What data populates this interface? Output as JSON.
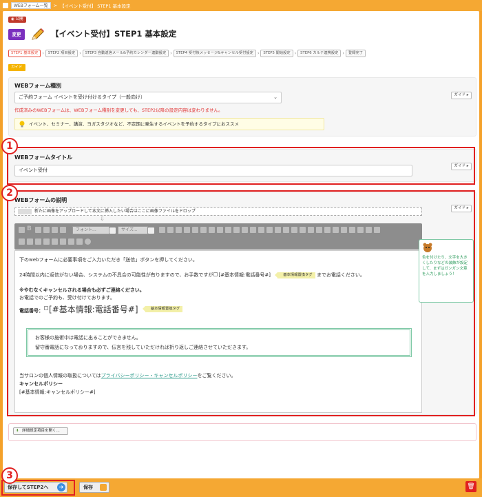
{
  "breadcrumb": {
    "home": "WEBフォーム一覧",
    "current": "【イベント受付】 STEP1 基本設定"
  },
  "status_badge": "公開",
  "edit_label": "変更",
  "page_title": "【イベント受付】STEP1 基本設定",
  "steps": [
    "STEP1 基本設定",
    "STEP2 項目設定",
    "STEP3 自動返信メール&予約カレンダー連動設定",
    "STEP4 受付後メッセージ&キャンセル受付設定",
    "STEP5 開始設定",
    "STEP6 カルテ連携設定",
    "登録完了"
  ],
  "guide_label": "ガイド",
  "form_type": {
    "title": "WEBフォーム種別",
    "selected": "ご予約フォーム イベントを受け付けるタイプ（一般向け）",
    "warning": "作成済みのWEBフォームは、WEBフォーム種別を変更しても、STEP2以降の設定内容は変わりません。",
    "hint": "イベント、セミナー、講演、ヨガスタジオなど、不定期に発生するイベントを予約するタイプにおススメ",
    "guide": "ガイド ▸"
  },
  "form_title_section": {
    "title": "WEBフォームタイトル",
    "value": "イベント受付",
    "guide": "ガイド ▸"
  },
  "description_section": {
    "title": "WEBフォームの説明",
    "guide": "ガイド ▸",
    "dropzone": "新たに画像をアップロードして本文に挿入したい場合はここに画像ファイルをドロップ",
    "font_placeholder": "フォント...",
    "size_placeholder": "サイズ...",
    "body": {
      "line1": "下のwebフォームに必要事項をご入力いただき「送信」ボタンを押してください。",
      "line2a": "24時間以内に返信がない場合、システムの不具合の可能性が有りますので、お手数ですが",
      "line2b": "[#基本情報:電話番号#]",
      "tag1": "基本情報置換タグ",
      "line2c": "までお電話ください。",
      "line3": "※やむなくキャンセルされる場合も必ずご連絡ください。",
      "line4": "お電話でのご予約も、受け付けております。",
      "phone_label": "電話番号：",
      "phone_tag": "[#基本情報:電話番号#]",
      "tag2": "基本情報置換タグ",
      "box_line1": "お客様の施術中は電話に出ることができません。",
      "box_line2": "留守番電話になっておりますので、伝言を残していただければ折り返しご連絡させていただきます。",
      "privacy_a": "当サロンの個人情報の取扱については",
      "privacy_link": "プライバシーポリシー・キャンセルポリシー",
      "privacy_b": "をご覧ください。",
      "cancel_title": "キャンセルポリシー",
      "cancel_tag": "[#基本情報:キャンセルポリシー#]"
    }
  },
  "mascot_tip": "色を付けたり、文字を大きくしたりなどの装飾が設定して、まずはガンガン文章を入力しましょう！",
  "advanced_label": "詳細設定項目を開く...",
  "footer": {
    "save_next": "保存してSTEP2へ",
    "save": "保存"
  },
  "markers": [
    "1",
    "2",
    "3"
  ],
  "colors": {
    "accent": "#f5a833",
    "edit": "#7b2fbe",
    "marker": "#e02020",
    "warning": "#e03030"
  }
}
